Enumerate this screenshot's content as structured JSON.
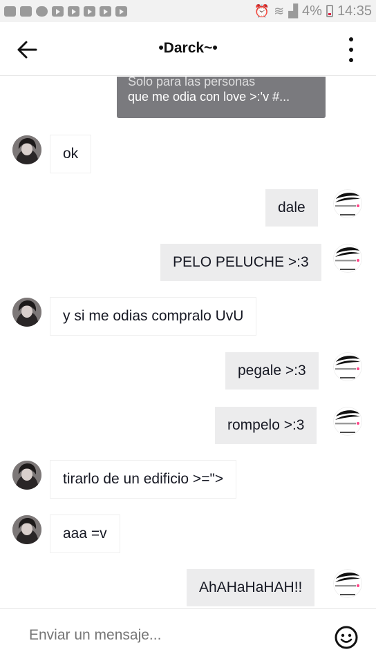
{
  "status_bar": {
    "battery": "4%",
    "time": "14:35"
  },
  "header": {
    "title": "•Darck~•"
  },
  "shared_post": {
    "line1": "Solo para las personas",
    "line2": "que me odia con love >:'v #..."
  },
  "messages": [
    {
      "side": "in",
      "text": "ok"
    },
    {
      "side": "out",
      "text": "dale"
    },
    {
      "side": "out",
      "text": "PELO PELUCHE >:3"
    },
    {
      "side": "in",
      "text": "y si me odias compralo UvU"
    },
    {
      "side": "out",
      "text": "pegale >:3"
    },
    {
      "side": "out",
      "text": "rompelo >:3"
    },
    {
      "side": "in",
      "text": "tirarlo de un edificio >=\">"
    },
    {
      "side": "in",
      "text": "aaa =v"
    },
    {
      "side": "out",
      "text": "AhAHaHaHAH!!"
    }
  ],
  "input": {
    "placeholder": "Enviar un mensaje..."
  },
  "icons": {
    "back": "arrow-left-icon",
    "more": "more-vertical-icon",
    "emoji": "emoji-icon"
  }
}
